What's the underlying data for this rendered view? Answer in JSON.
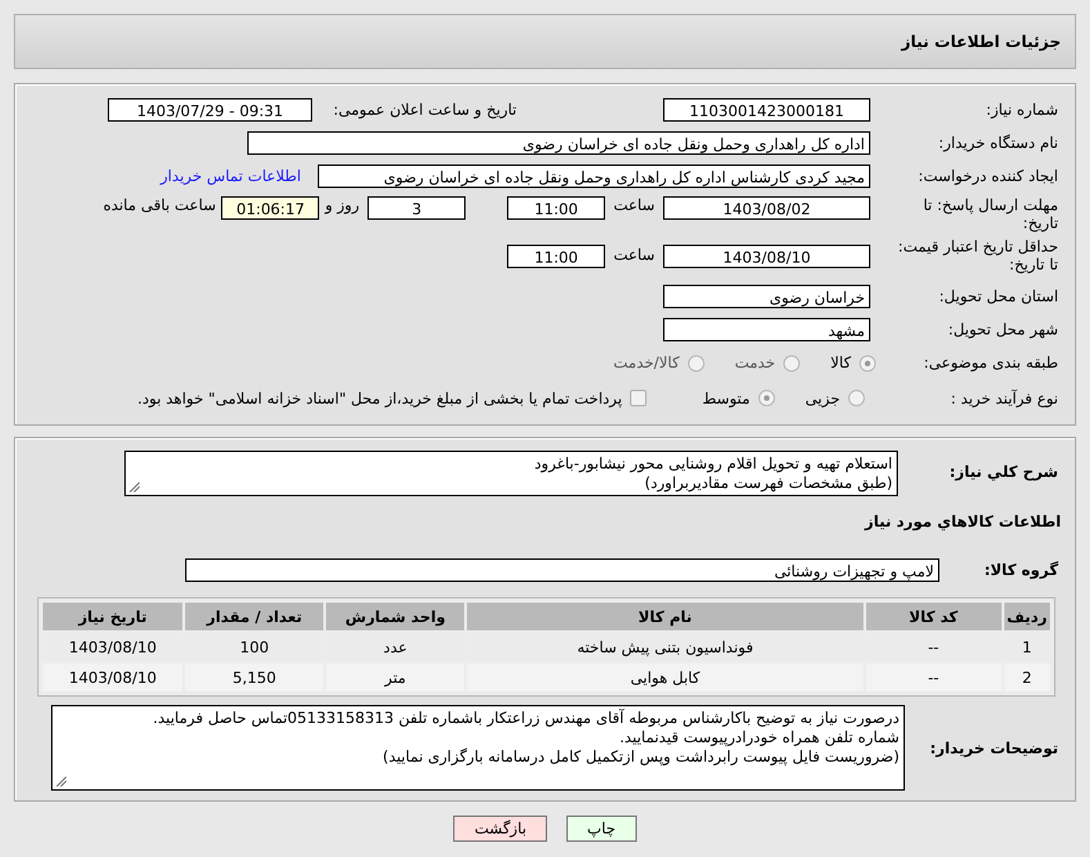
{
  "header": {
    "title": "جزئیات اطلاعات نیاز"
  },
  "need_number": {
    "label": "شماره نیاز:",
    "value": "1103001423000181"
  },
  "announce": {
    "label": "تاریخ و ساعت اعلان عمومی:",
    "value": "1403/07/29 - 09:31"
  },
  "buyer_org": {
    "label": "نام دستگاه خریدار:",
    "value": "اداره کل راهداری وحمل ونقل جاده ای خراسان رضوی"
  },
  "creator": {
    "label": "ایجاد کننده درخواست:",
    "value": "مجید کردی کارشناس اداره کل راهداری وحمل ونقل جاده ای خراسان رضوی",
    "link": "اطلاعات تماس خریدار"
  },
  "reply_deadline": {
    "label": "مهلت ارسال پاسخ: تا تاریخ:",
    "date": "1403/08/02",
    "time_label": "ساعت",
    "time": "11:00",
    "days": "3",
    "days_label": "روز و",
    "remaining": "01:06:17",
    "remaining_label": "ساعت باقی مانده"
  },
  "price_validity": {
    "label": "حداقل تاریخ اعتبار قیمت: تا تاریخ:",
    "date": "1403/08/10",
    "time_label": "ساعت",
    "time": "11:00"
  },
  "province": {
    "label": "استان محل تحویل:",
    "value": "خراسان رضوی"
  },
  "city": {
    "label": "شهر محل تحویل:",
    "value": "مشهد"
  },
  "category": {
    "label": "طبقه بندی موضوعی:",
    "options": [
      {
        "label": "کالا",
        "selected": true
      },
      {
        "label": "خدمت",
        "selected": false
      },
      {
        "label": "کالا/خدمت",
        "selected": false
      }
    ]
  },
  "purchase_type": {
    "label": "نوع فرآیند خرید :",
    "options": [
      {
        "label": "جزیی",
        "selected": false
      },
      {
        "label": "متوسط",
        "selected": true
      }
    ],
    "payment_note": {
      "label": "پرداخت تمام یا بخشی از مبلغ خرید،از محل \"اسناد خزانه اسلامی\" خواهد بود.",
      "checked": false
    }
  },
  "description": {
    "label": "شرح کلي نیاز:",
    "value": "استعلام تهیه و تحویل اقلام روشنایی محور نیشابور-باغرود\n(طبق مشخصات فهرست مقادیربراورد)"
  },
  "goods_heading": "اطلاعات کالاهاي مورد نیاز",
  "goods_group": {
    "label": "گروه کالا:",
    "value": "لامپ و تجهیزات روشنائی"
  },
  "table": {
    "columns": [
      "ردیف",
      "کد کالا",
      "نام کالا",
      "واحد شمارش",
      "تعداد / مقدار",
      "تاریخ نیاز"
    ],
    "rows": [
      [
        "1",
        "--",
        "فونداسیون بتنی پیش ساخته",
        "عدد",
        "100",
        "1403/08/10"
      ],
      [
        "2",
        "--",
        "کابل هوایی",
        "متر",
        "5,150",
        "1403/08/10"
      ]
    ]
  },
  "buyer_notes": {
    "label": "توضیحات خریدار:",
    "value": "درصورت نیاز به توضیح باکارشناس مربوطه آقای مهندس زراعتکار باشماره تلفن 05133158313تماس حاصل فرمایید.\nشماره تلفن همراه خودرادرپیوست قیدنمایید.\n(ضروریست فایل پیوست رابرداشت وپس ازتکمیل کامل درسامانه بارگزاری نمایید)"
  },
  "buttons": [
    {
      "label": "چاپ",
      "kind": "print"
    },
    {
      "label": "بازگشت",
      "kind": "back"
    }
  ]
}
